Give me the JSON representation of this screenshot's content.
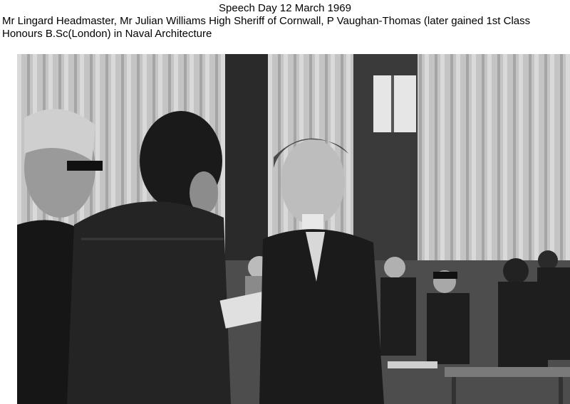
{
  "caption": {
    "title": "Speech Day 12 March 1969",
    "line1": "Mr Lingard Headmaster, Mr Julian Williams High Sheriff of Cornwall, P Vaughan-Thomas (later gained 1st Class",
    "line2": "Honours B.Sc(London) in Naval Architecture"
  },
  "photo": {
    "tone": "black-and-white",
    "colors": {
      "dark": "#141414",
      "mid": "#6e6e6e",
      "light": "#d4d4d4",
      "curtain": "#bdbdbd"
    }
  }
}
